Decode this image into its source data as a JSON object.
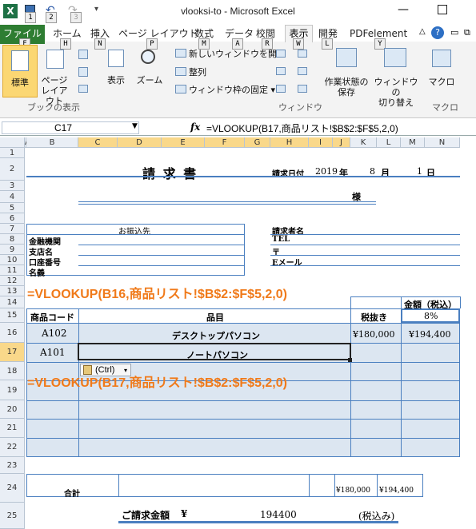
{
  "window": {
    "title": "vlooksi-to - Microsoft Excel"
  },
  "qat": {
    "keys": [
      "1",
      "2",
      "3"
    ]
  },
  "tabs": {
    "file": "ファイル",
    "home": "ホーム",
    "insert": "挿入",
    "layout": "ページ レイアウト",
    "formulas": "数式",
    "data": "データ",
    "review": "校閲",
    "view": "表示",
    "developer": "開発",
    "pdf": "PDFelement"
  },
  "keytips": {
    "file": "F",
    "home": "H",
    "insert": "N",
    "layout": "P",
    "formulas": "M",
    "data": "A",
    "review": "R",
    "view": "W",
    "developer": "L",
    "pdf": "Y"
  },
  "ribbon": {
    "normal": "標準",
    "page_layout": "ページ\nレイアウト",
    "show": "表示",
    "zoom": "ズーム",
    "new_window": "新しいウィンドウを開く",
    "arrange": "整列",
    "freeze": "ウィンドウ枠の固定",
    "save_ws": "作業状態の\n保存",
    "switch": "ウィンドウの\n切り替え",
    "macro": "マクロ",
    "grp_book": "ブックの表示",
    "grp_window": "ウィンドウ",
    "grp_macro": "マクロ"
  },
  "formula_bar": {
    "cell": "C17",
    "fx": "fx",
    "formula": "=VLOOKUP(B17,商品リスト!$B$2:$F$5,2,0)"
  },
  "columns": [
    "A",
    "B",
    "C",
    "D",
    "E",
    "F",
    "G",
    "H",
    "I",
    "J",
    "K",
    "L",
    "M",
    "N"
  ],
  "rows": [
    "1",
    "2",
    "3",
    "4",
    "5",
    "6",
    "7",
    "8",
    "9",
    "10",
    "11",
    "12",
    "13",
    "14",
    "15",
    "16",
    "17",
    "18",
    "19",
    "20",
    "21",
    "22",
    "23",
    "24",
    "25"
  ],
  "sheet": {
    "title": "請 求 書",
    "date_label": "請求日付",
    "year": "2019",
    "nen": "年",
    "month": "8",
    "tsuki": "月",
    "day": "1",
    "nichi": "日",
    "sama": "様",
    "bank_header": "お振込先",
    "bank_labels": [
      "金融機関",
      "支店名",
      "口座番号",
      "名義"
    ],
    "req_labels": [
      "請求者名",
      "TEL",
      "〒",
      "Eメール"
    ],
    "amount_tax_hdr": "金額（税込）",
    "h_code": "商品コード",
    "h_item": "品目",
    "h_taxex": "税抜き",
    "tax_rate": "8%",
    "row16": {
      "code": "A102",
      "item": "デスクトップパソコン",
      "taxex": "¥180,000",
      "amount": "¥194,400"
    },
    "row17": {
      "code": "A101",
      "item": "ノートパソコン"
    },
    "paste_tag": "(Ctrl)",
    "total_label": "合計",
    "total_taxex": "¥180,000",
    "total_amount": "¥194,400",
    "grand_label": "ご請求金額",
    "yen": "¥",
    "grand_value": "194400",
    "grand_note": "(税込み)"
  },
  "overlay": {
    "formula1": "=VLOOKUP(B16,商品リスト!$B$2:$F$5,2,0)",
    "formula2": "=VLOOKUP(B17,商品リスト!$B$2:$F$5,2,0)"
  },
  "colors": {
    "accent": "#4a7fc0",
    "overlay": "#f07a1a",
    "file_tab": "#2e7d32"
  }
}
